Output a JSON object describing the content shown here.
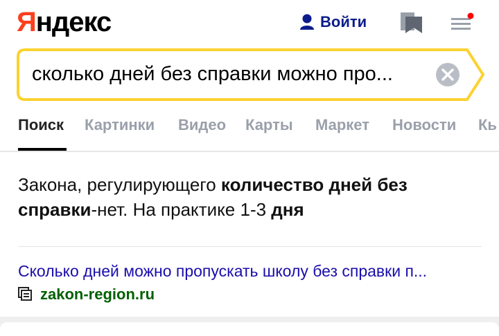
{
  "header": {
    "logo_first": "Я",
    "logo_rest": "ндекс",
    "login_label": "Войти"
  },
  "search": {
    "query": "сколько дней без справки можно про..."
  },
  "tabs": [
    {
      "label": "Поиск"
    },
    {
      "label": "Картинки"
    },
    {
      "label": "Видео"
    },
    {
      "label": "Карты"
    },
    {
      "label": "Маркет"
    },
    {
      "label": "Новости"
    },
    {
      "label": "Кь"
    }
  ],
  "answer": {
    "part1": "Закона, регулирующего ",
    "bold1": "количество дней без справки",
    "part2": "-нет. На практике 1-3 ",
    "bold2": "дня"
  },
  "result": {
    "title": "Сколько дней можно пропускать школу без справки п...",
    "domain": "zakon-region.ru"
  },
  "colors": {
    "logo_red": "#fc3f1d",
    "search_border": "#fcd22f",
    "link": "#1a0dab",
    "domain": "#006000",
    "notification_dot": "#ff0000"
  }
}
